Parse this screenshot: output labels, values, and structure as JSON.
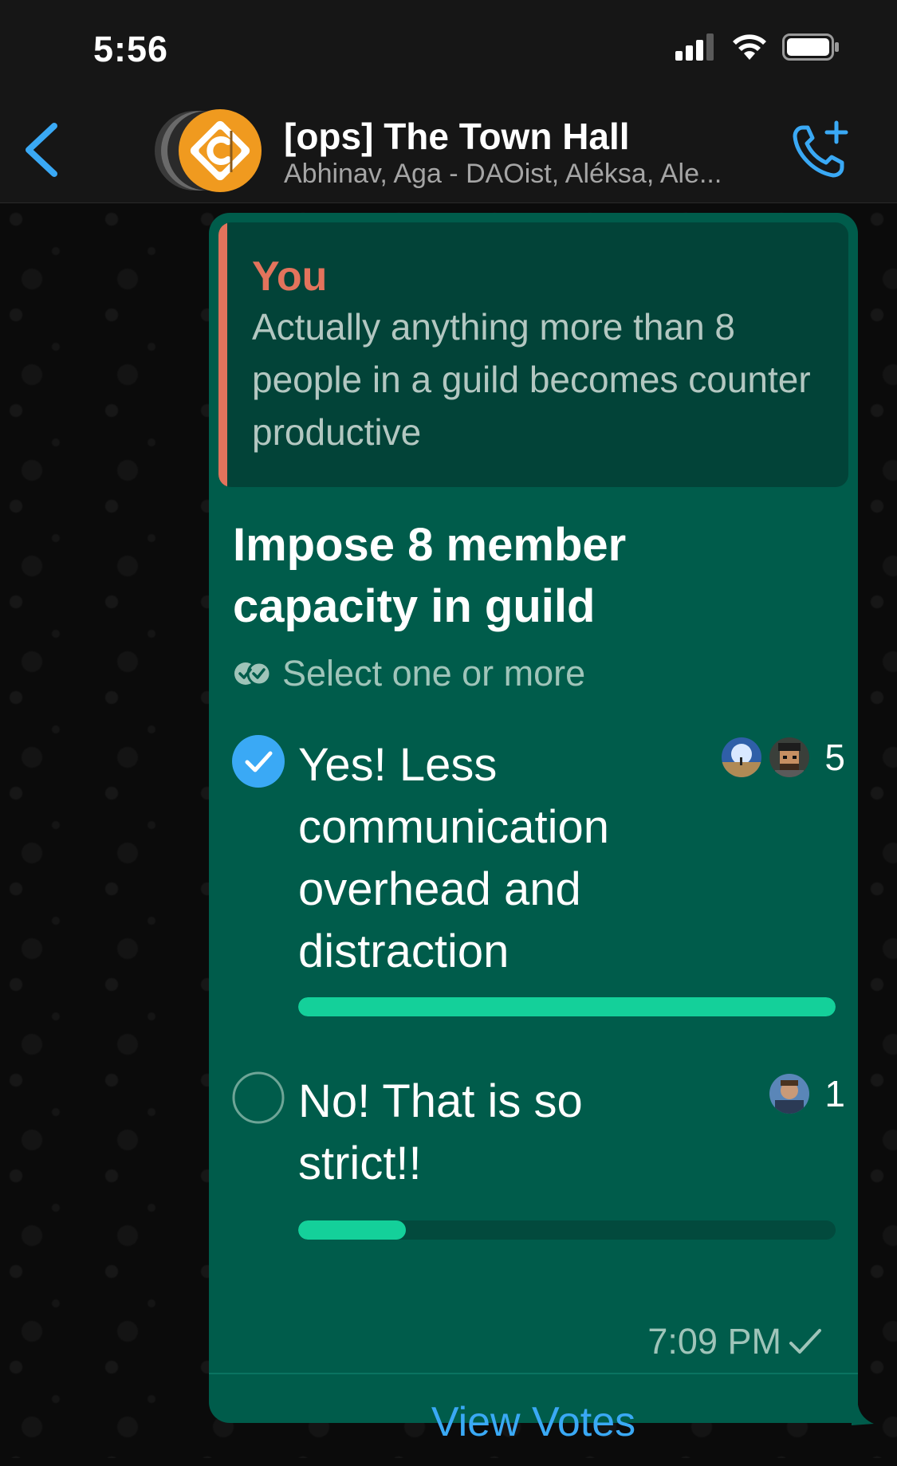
{
  "status_bar": {
    "time": "5:56"
  },
  "header": {
    "title": "[ops] The Town Hall",
    "subtitle": "Abhinav, Aga - DAOist, Aléksa, Ale..."
  },
  "message": {
    "quoted": {
      "author": "You",
      "text": "Actually anything more than 8 people in a guild becomes counter productive"
    },
    "poll": {
      "question": "Impose 8 member capacity in guild",
      "hint": "Select one or more",
      "options": [
        {
          "label": "Yes! Less communication overhead and distraction",
          "votes": "5",
          "checked": true,
          "fill_fraction": 1.0
        },
        {
          "label": "No! That is so strict!!",
          "votes": "1",
          "checked": false,
          "fill_fraction": 0.2
        }
      ]
    },
    "time": "7:09 PM",
    "action": "View Votes"
  },
  "colors": {
    "bubble": "#005c4b",
    "accent_blue": "#3aa9f5",
    "progress": "#14d09a",
    "quote_author": "#e3735c"
  }
}
